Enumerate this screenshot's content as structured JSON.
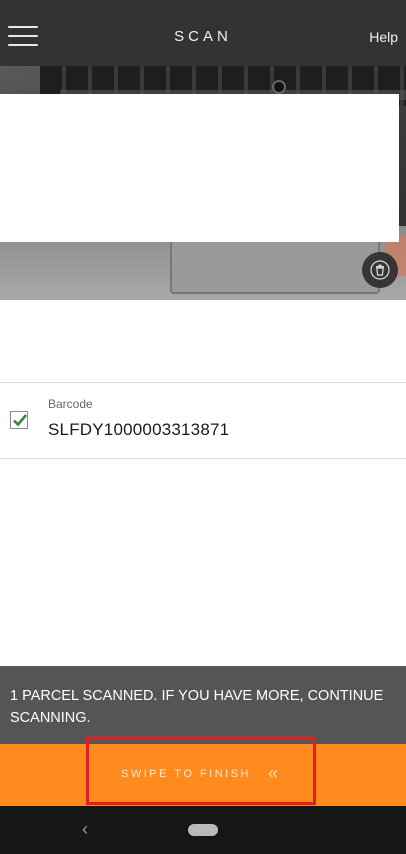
{
  "header": {
    "title": "SCAN",
    "help_label": "Help"
  },
  "scanned_item": {
    "field_label": "Barcode",
    "value": "SLFDY1000003313871",
    "checked": true
  },
  "status": {
    "message": "1 PARCEL SCANNED. IF YOU HAVE MORE, CONTINUE SCANNING."
  },
  "action": {
    "swipe_label": "SWIPE TO FINISH",
    "chevron_glyph": "«"
  },
  "icons": {
    "menu": "hamburger-menu-icon",
    "delete": "trash-icon",
    "check": "checkmark-icon",
    "nav_back": "chevron-left-icon",
    "nav_home": "home-pill-icon"
  },
  "colors": {
    "header_bg": "#333333",
    "status_bg": "#555555",
    "accent_orange": "#ff8a1e",
    "highlight_red": "#e02020",
    "check_green": "#2e8b3a"
  },
  "system_nav": {
    "back_glyph": "‹"
  }
}
